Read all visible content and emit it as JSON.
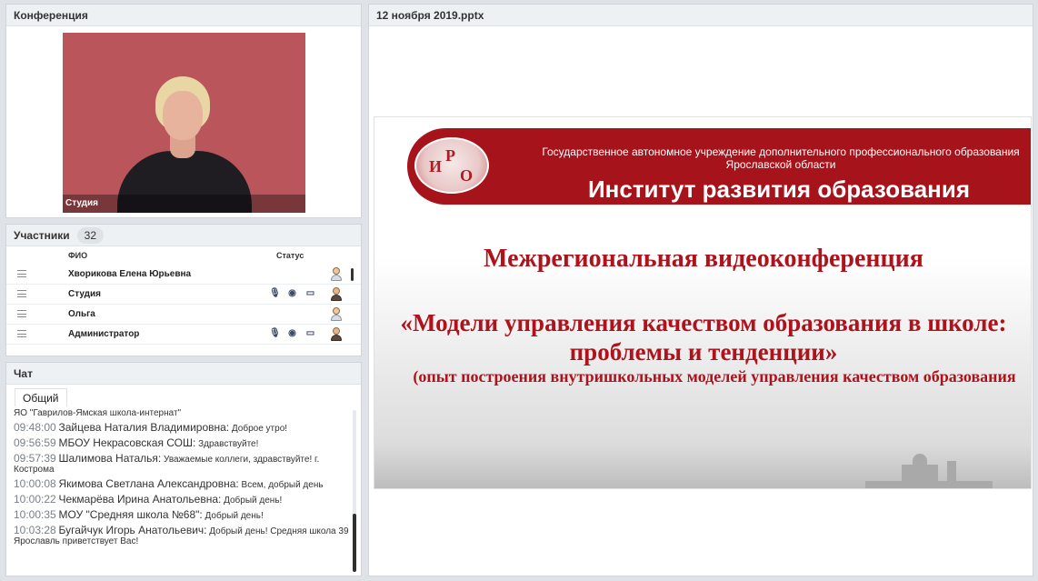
{
  "conference": {
    "title": "Конференция",
    "video_caption": "Студия"
  },
  "participants": {
    "title": "Участники",
    "count": "32",
    "col_fio": "ФИО",
    "col_status": "Статус",
    "rows": [
      {
        "name": "Хворикова Елена  Юрьевна",
        "icons": [
          "",
          "",
          ""
        ],
        "avatar": "light"
      },
      {
        "name": "Студия",
        "icons": [
          "🎙",
          "◉",
          "▭"
        ],
        "avatar": "dark"
      },
      {
        "name": "Ольга",
        "icons": [
          "",
          "",
          ""
        ],
        "avatar": "light"
      },
      {
        "name": "Администратор",
        "icons": [
          "🎙",
          "◉",
          "▭"
        ],
        "avatar": "dark"
      }
    ]
  },
  "chat": {
    "title": "Чат",
    "tab": "Общий",
    "messages": [
      {
        "time": "",
        "author": "",
        "text": "ЯО \"Гаврилов-Ямская школа-интернат\""
      },
      {
        "time": "09:48:00",
        "author": "Зайцева Наталия  Владимировна:",
        "text": "Доброе утро!"
      },
      {
        "time": "09:56:59",
        "author": "МБОУ Некрасовская СОШ:",
        "text": "Здравствуйте!"
      },
      {
        "time": "09:57:39",
        "author": "Шалимова Наталья:",
        "text": "Уважаемые коллеги, здравствуйте! г. Кострома"
      },
      {
        "time": "10:00:08",
        "author": "Якимова Светлана  Александровна:",
        "text": "Всем, добрый день"
      },
      {
        "time": "10:00:22",
        "author": "Чекмарёва Ирина Анатольевна:",
        "text": "Добрый день!"
      },
      {
        "time": "10:00:35",
        "author": "МОУ \"Средняя школа №68\":",
        "text": "Добрый день!"
      },
      {
        "time": "10:03:28",
        "author": "Бугайчук Игорь Анатольевич:",
        "text": "Добрый день! Средняя школа  39 Ярославль приветствует Вас!"
      }
    ]
  },
  "presentation": {
    "title": "12 ноября 2019.pptx",
    "banner_sub": "Государственное автономное учреждение дополнительного профессионального образования Ярославской области",
    "banner_title": "Институт развития образования",
    "logo_letters": [
      "И",
      "Р",
      "О"
    ],
    "slide_title": "Межрегиональная видеоконференция",
    "slide_subtitle": "«Модели управления качеством образования в школе: проблемы и тенденции»",
    "slide_note": "(опыт построения внутришкольных моделей управления качеством образования"
  },
  "colors": {
    "accent_red": "#a6131b",
    "panel_header": "#eef1f4"
  }
}
